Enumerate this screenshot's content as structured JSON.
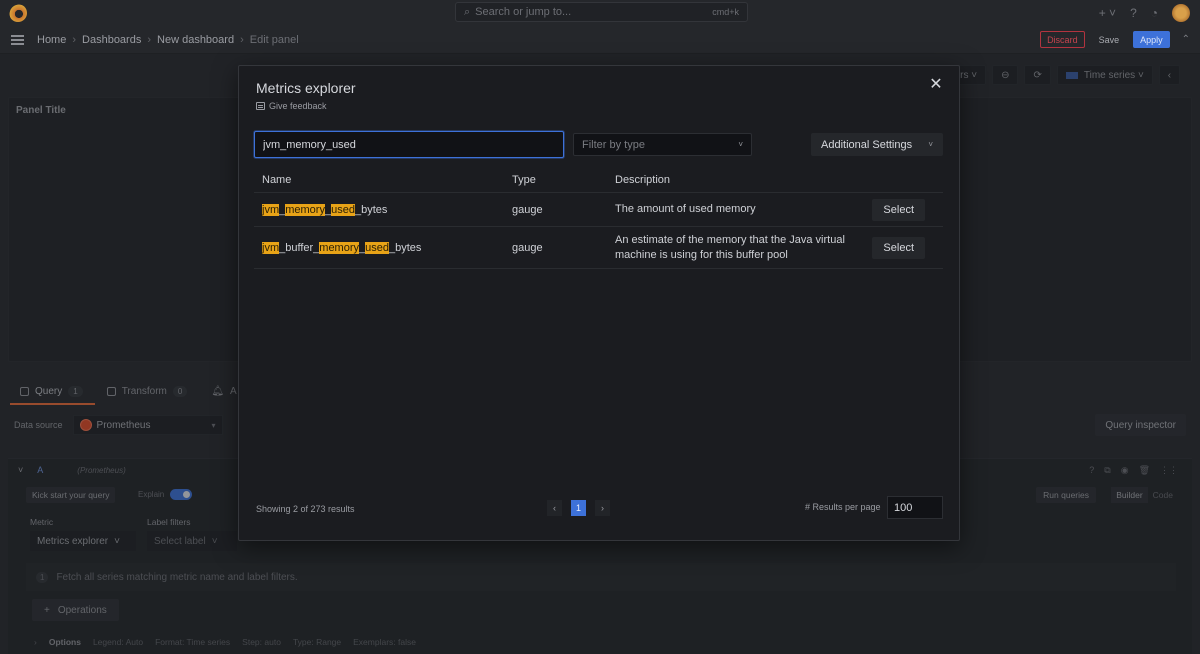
{
  "topbar": {
    "search_placeholder": "Search or jump to...",
    "search_shortcut": "cmd+k",
    "add_label": "+ ˅"
  },
  "breadcrumb": [
    "Home",
    "Dashboards",
    "New dashboard",
    "Edit panel"
  ],
  "breadcrumb_sep": "›",
  "nav_actions": {
    "discard": "Discard",
    "save": "Save",
    "apply": "Apply"
  },
  "panel_toolbar": {
    "time_range": "ours ˅",
    "viz": "Time series ˅"
  },
  "panel": {
    "title": "Panel Title"
  },
  "tabs": [
    {
      "label": "Query",
      "count": "1"
    },
    {
      "label": "Transform",
      "count": "0"
    },
    {
      "label": "A"
    }
  ],
  "datasource": {
    "label": "Data source",
    "value": "Prometheus"
  },
  "query_inspector": "Query inspector",
  "query": {
    "letter": "A",
    "datasource": "(Prometheus)",
    "kick_start": "Kick start your query",
    "explain": "Explain",
    "run_queries": "Run queries",
    "modes": [
      "Builder",
      "Code"
    ],
    "metric_label": "Metric",
    "label_filters_label": "Label filters",
    "metric_value": "Metrics explorer",
    "label_placeholder": "Select label",
    "hint_num": "1",
    "hint": "Fetch all series matching metric name and label filters.",
    "operations": "Operations",
    "options_title": "Options",
    "options": [
      "Legend: Auto",
      "Format: Time series",
      "Step: auto",
      "Type: Range",
      "Exemplars: false"
    ]
  },
  "modal": {
    "title": "Metrics explorer",
    "feedback": "Give feedback",
    "search_value": "jvm_memory_used",
    "type_filter_placeholder": "Filter by type",
    "settings": "Additional Settings",
    "columns": [
      "Name",
      "Type",
      "Description"
    ],
    "rows": [
      {
        "name_parts": [
          [
            "jvm",
            true
          ],
          [
            "_",
            false
          ],
          [
            "memory",
            true
          ],
          [
            "_",
            false
          ],
          [
            "used",
            true
          ],
          [
            "_bytes",
            false
          ]
        ],
        "type": "gauge",
        "description": "The amount of used memory",
        "action": "Select"
      },
      {
        "name_parts": [
          [
            "jvm",
            true
          ],
          [
            "_buffer_",
            false
          ],
          [
            "memory",
            true
          ],
          [
            "_",
            false
          ],
          [
            "used",
            true
          ],
          [
            "_bytes",
            false
          ]
        ],
        "type": "gauge",
        "description": "An estimate of the memory that the Java virtual machine is using for this buffer pool",
        "action": "Select"
      }
    ],
    "showing": "Showing 2 of 273 results",
    "page": "1",
    "results_per_page_label": "# Results per page",
    "results_per_page": "100"
  },
  "colors": {
    "accent": "#3d71d9",
    "highlight": "#e8a317",
    "danger": "#c4444e",
    "tab_underline": "#e0693a"
  }
}
